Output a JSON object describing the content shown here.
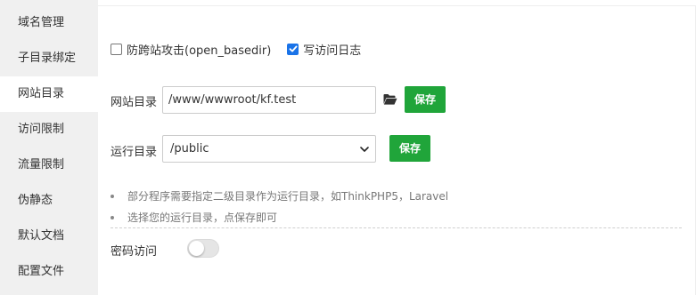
{
  "sidebar": {
    "items": [
      {
        "label": "域名管理"
      },
      {
        "label": "子目录绑定"
      },
      {
        "label": "网站目录",
        "active": true
      },
      {
        "label": "访问限制"
      },
      {
        "label": "流量限制"
      },
      {
        "label": "伪静态"
      },
      {
        "label": "默认文档"
      },
      {
        "label": "配置文件"
      }
    ]
  },
  "options": {
    "open_basedir_label": "防跨站攻击(open_basedir)",
    "open_basedir_checked": false,
    "access_log_label": "写访问日志",
    "access_log_checked": true
  },
  "site_dir": {
    "label": "网站目录",
    "value": "/www/wwwroot/kf.test",
    "icon": "folder-icon",
    "save_label": "保存"
  },
  "run_dir": {
    "label": "运行目录",
    "selected": "/public",
    "save_label": "保存"
  },
  "tips": [
    "部分程序需要指定二级目录作为运行目录，如ThinkPHP5，Laravel",
    "选择您的运行目录，点保存即可"
  ],
  "password_access": {
    "label": "密码访问",
    "enabled": false
  },
  "colors": {
    "accent_green": "#20a53a",
    "checkbox_blue": "#1a73e8",
    "sidebar_bg": "#f0f0f0"
  }
}
